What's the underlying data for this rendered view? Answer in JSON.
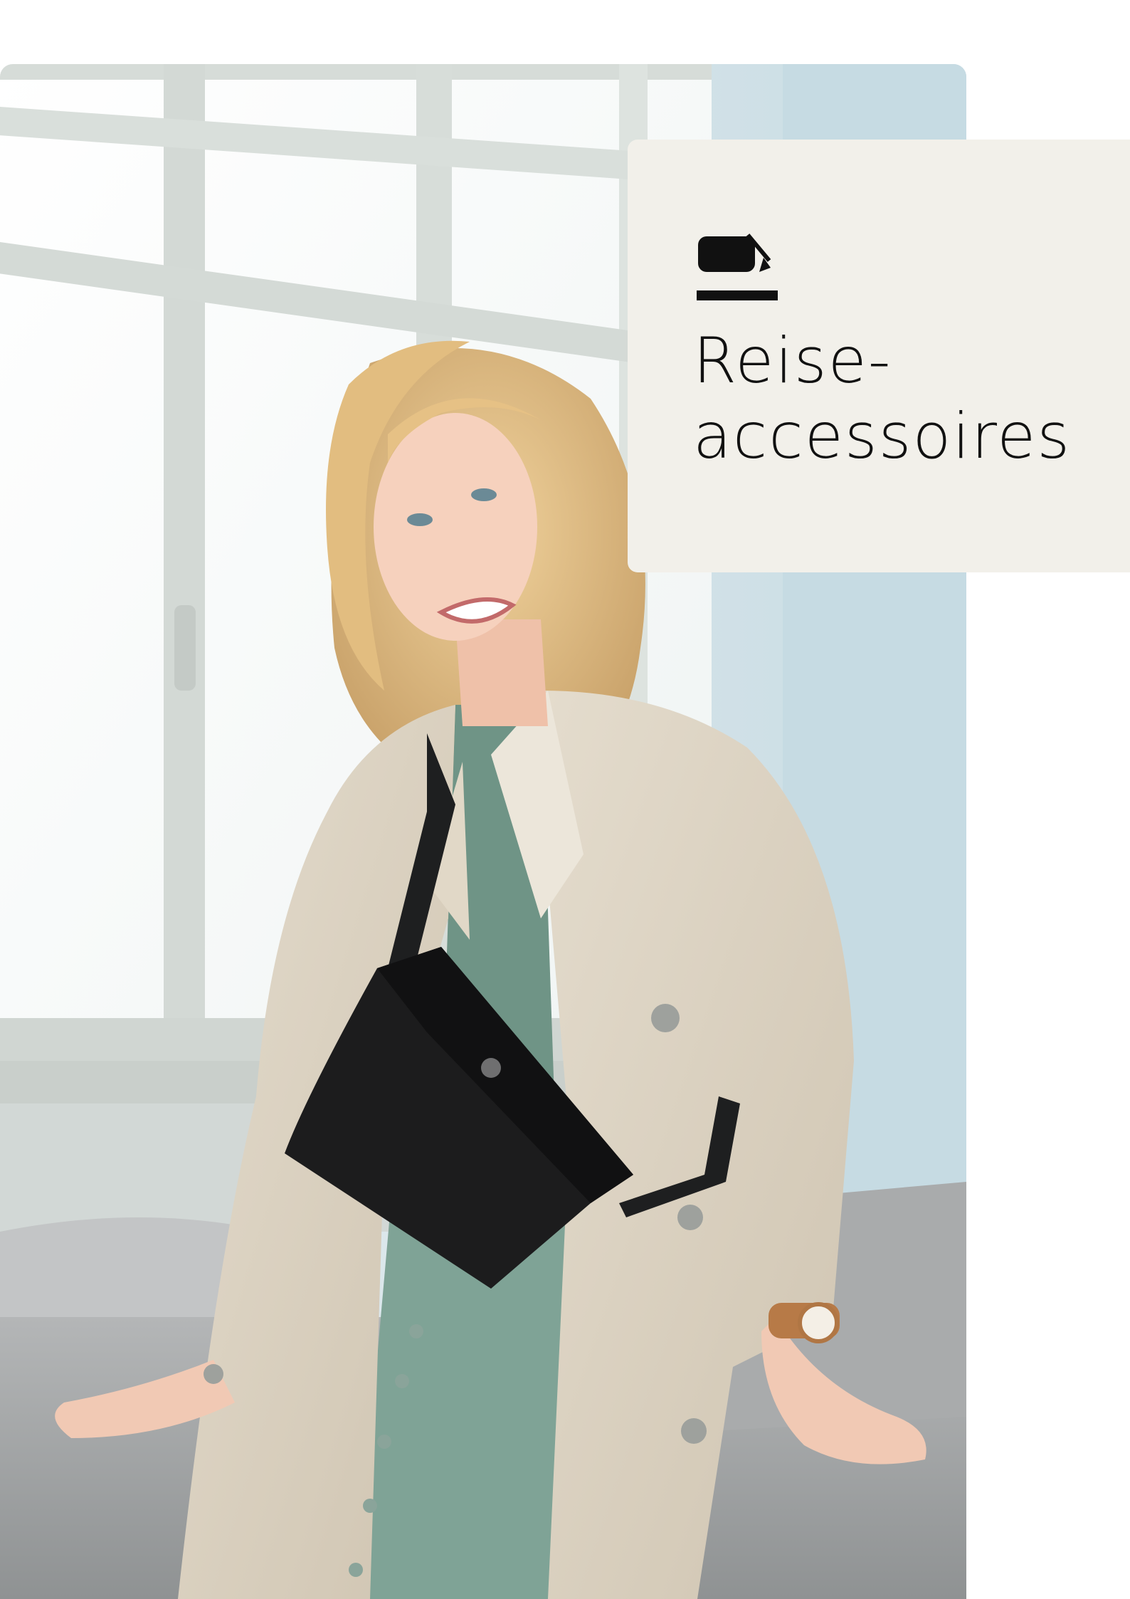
{
  "header": {
    "title_line1": "Reise-",
    "title_line2": "accessoires",
    "icon": "bag-icon"
  },
  "colors": {
    "card_background": "#f2f0ea",
    "text": "#111111"
  },
  "photo": {
    "subject": "bag-icon"
  }
}
